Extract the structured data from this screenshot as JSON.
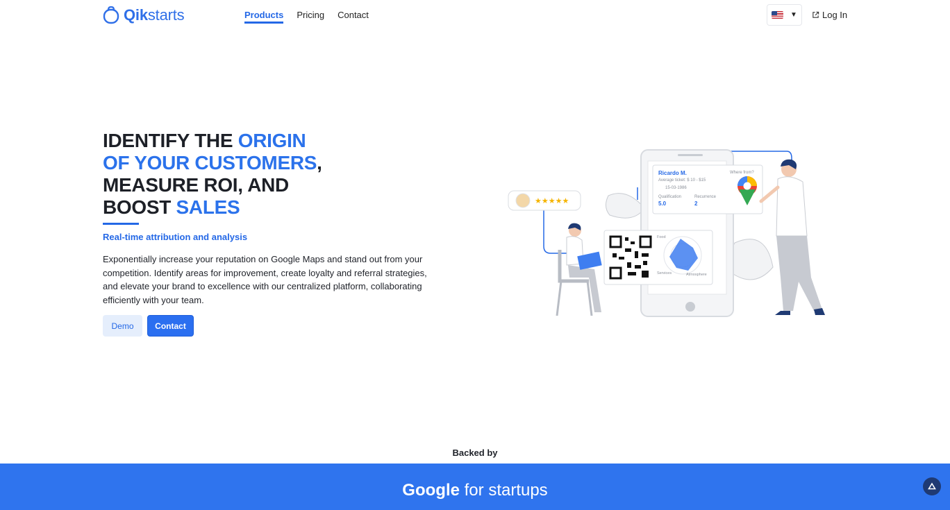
{
  "brand": {
    "name_bold": "Qik",
    "name_rest": "starts",
    "accent": "#2468e6"
  },
  "nav": {
    "items": [
      {
        "label": "Products",
        "active": true
      },
      {
        "label": "Pricing",
        "active": false
      },
      {
        "label": "Contact",
        "active": false
      }
    ]
  },
  "header": {
    "language_icon": "us-flag-icon",
    "language_caret": "▼",
    "login_label": "Log In"
  },
  "hero": {
    "title_1": "IDENTIFY THE ",
    "title_2": "ORIGIN",
    "title_3": "OF YOUR CUSTOMERS",
    "title_4": ",",
    "title_5": "MEASURE ROI, AND",
    "title_6": "BOOST ",
    "title_7": "SALES",
    "subtitle": "Real-time attribution and analysis",
    "description": "Exponentially increase your reputation on Google Maps and stand out from your competition. Identify areas for improvement, create loyalty and referral strategies, and elevate your brand to excellence with our centralized platform, collaborating efficiently with your team.",
    "demo_label": "Demo",
    "contact_label": "Contact"
  },
  "illustration": {
    "stars": "★★★★★",
    "card_name": "Ricardo M.",
    "card_ticket": "Average ticket: $ 10 - $15",
    "card_date": "15-03-1986",
    "card_qual_label": "Qualification",
    "card_qual_value": "5.0",
    "card_rec_label": "Recurrence",
    "card_rec_value": "2",
    "where_from": "Where from?",
    "radar_food": "Food",
    "radar_services": "Services",
    "radar_atmosphere": "Atmosphere"
  },
  "backed": {
    "label": "Backed by",
    "partner_bold": "Google",
    "partner_rest": " for startups"
  }
}
